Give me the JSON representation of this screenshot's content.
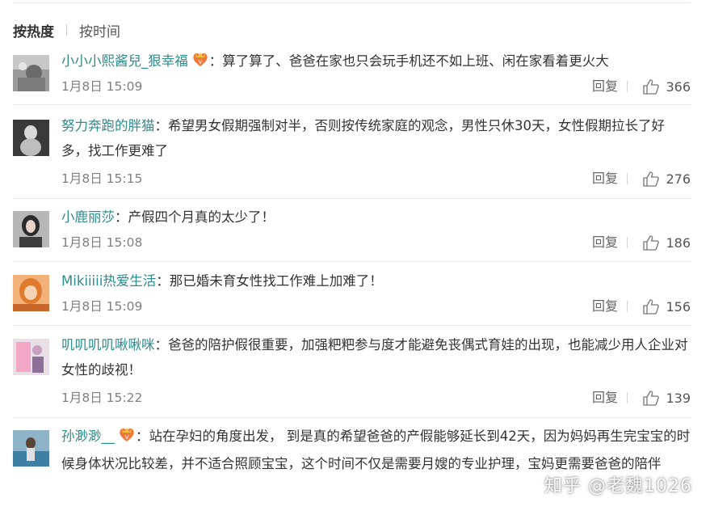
{
  "sort": {
    "hot": "按热度",
    "time": "按时间"
  },
  "reply_label": "回复",
  "comments": [
    {
      "user": "小小小熙酱兒_狠幸福",
      "has_badge": true,
      "sep": "：",
      "text": "算了算了、爸爸在家也只会玩手机还不如上班、闲在家看着更火大",
      "time": "1月8日 15:09",
      "likes": "366"
    },
    {
      "user": "努力奔跑的胖猫",
      "has_badge": false,
      "sep": "：",
      "text": "希望男女假期强制对半，否则按传统家庭的观念，男性只休30天，女性假期拉长了好多，找工作更难了",
      "time": "1月8日 15:15",
      "likes": "276"
    },
    {
      "user": "小鹿丽莎",
      "has_badge": false,
      "sep": "：",
      "text": "产假四个月真的太少了！",
      "time": "1月8日 15:08",
      "likes": "186"
    },
    {
      "user": "Mikiiiii热爱生活",
      "has_badge": false,
      "sep": "：",
      "text": "那已婚未育女性找工作难上加难了！",
      "time": "1月8日 15:09",
      "likes": "156"
    },
    {
      "user": "叽叽叽叽啾啾咪",
      "has_badge": false,
      "sep": "：",
      "text": "爸爸的陪护假很重要，加强粑粑参与度才能避免丧偶式育娃的出现，也能减少用人企业对女性的歧视！",
      "time": "1月8日 15:22",
      "likes": "139"
    },
    {
      "user": "孙渺渺__",
      "has_badge": true,
      "sep": "：",
      "text": "站在孕妇的角度出发， 到是真的希望爸爸的产假能够延长到42天，因为妈妈再生完宝宝的时候身体状况比较差，并不适合照顾宝宝，这个时间不仅是需要月嫂的专业护理，宝妈更需要爸爸的陪伴",
      "time": "",
      "likes": ""
    }
  ],
  "watermark": "知乎 @老魏1026",
  "colors": {
    "username": "#2d8c8c",
    "divider": "#ececec",
    "meta": "#808080"
  }
}
